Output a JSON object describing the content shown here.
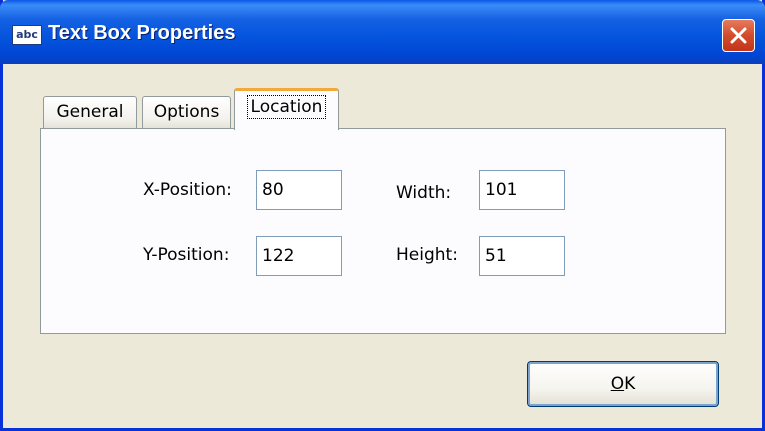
{
  "window": {
    "title": "Text Box Properties",
    "app_icon_text": "abc",
    "title_bar_color": "#0453dc",
    "close_button_color": "#d24c2c"
  },
  "tabs": [
    {
      "label": "General",
      "selected": false
    },
    {
      "label": "Options",
      "selected": false
    },
    {
      "label": "Location",
      "selected": true
    }
  ],
  "location": {
    "x_position": {
      "label": "X-Position:",
      "value": "80"
    },
    "y_position": {
      "label": "Y-Position:",
      "value": "122"
    },
    "width": {
      "label": "Width:",
      "value": "101"
    },
    "height": {
      "label": "Height:",
      "value": "51"
    }
  },
  "buttons": {
    "ok_mnemonic": "O",
    "ok_rest": "K"
  }
}
